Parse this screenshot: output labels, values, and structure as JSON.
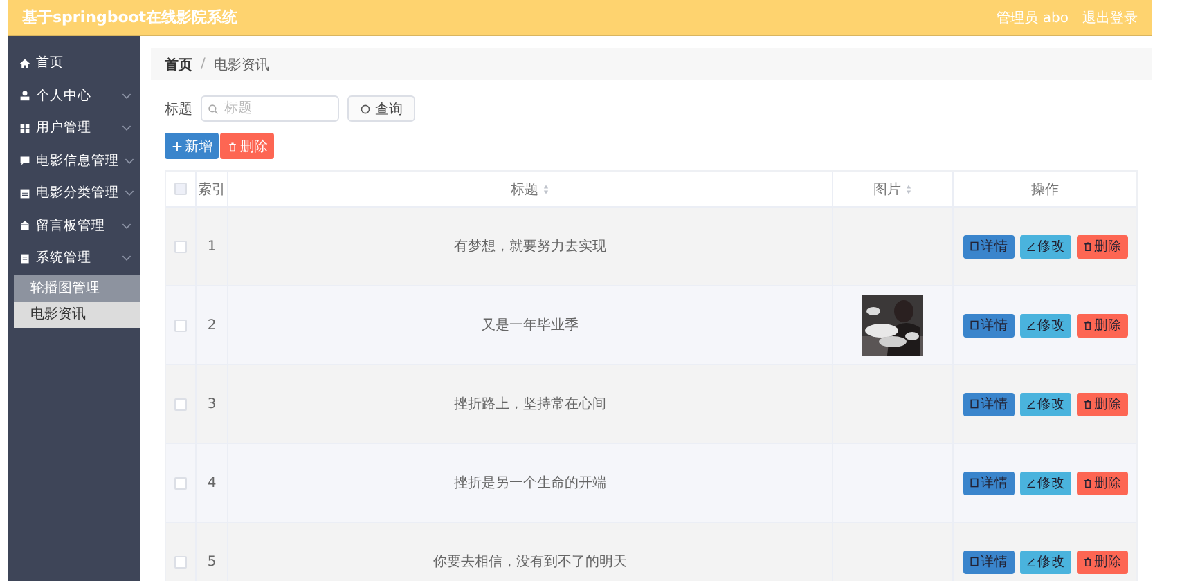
{
  "header": {
    "title": "基于springboot在线影院系统",
    "user": "管理员 abo",
    "logout": "退出登录"
  },
  "sidebar": {
    "items": [
      {
        "label": "首页",
        "kind": "home",
        "expandable": false
      },
      {
        "label": "个人中心",
        "kind": "user",
        "expandable": true
      },
      {
        "label": "用户管理",
        "kind": "grid",
        "expandable": true
      },
      {
        "label": "电影信息管理",
        "kind": "chat",
        "expandable": true
      },
      {
        "label": "电影分类管理",
        "kind": "list",
        "expandable": true
      },
      {
        "label": "留言板管理",
        "kind": "shop",
        "expandable": true
      },
      {
        "label": "系统管理",
        "kind": "doc",
        "expandable": true,
        "children": [
          {
            "label": "轮播图管理",
            "selected": false
          },
          {
            "label": "电影资讯",
            "selected": true
          }
        ]
      }
    ]
  },
  "breadcrumb": {
    "items": [
      "首页",
      "电影资讯"
    ],
    "separator": "/"
  },
  "search": {
    "label": "标题",
    "placeholder": "标题",
    "button": "查询"
  },
  "actions": [
    {
      "label": "新增",
      "kind": "add"
    },
    {
      "label": "删除",
      "kind": "delete"
    }
  ],
  "table": {
    "all_checked": false,
    "columns": [
      {
        "label": "索引",
        "sortable": false
      },
      {
        "label": "标题",
        "sortable": true
      },
      {
        "label": "图片",
        "sortable": true
      },
      {
        "label": "操作",
        "sortable": false
      }
    ],
    "rows": [
      {
        "checked": false,
        "index": "1",
        "title": "有梦想，就要努力去实现",
        "picture": false,
        "buttons": [
          "详情",
          "修改",
          "删除"
        ]
      },
      {
        "checked": false,
        "index": "2",
        "title": "又是一年毕业季",
        "picture": true,
        "buttons": [
          "详情",
          "修改",
          "删除"
        ]
      },
      {
        "checked": false,
        "index": "3",
        "title": "挫折路上，坚持常在心间",
        "picture": false,
        "buttons": [
          "详情",
          "修改",
          "删除"
        ]
      },
      {
        "checked": false,
        "index": "4",
        "title": "挫折是另一个生命的开端",
        "picture": false,
        "buttons": [
          "详情",
          "修改",
          "删除"
        ]
      },
      {
        "checked": false,
        "index": "5",
        "title": "你要去相信，没有到不了的明天",
        "picture": false,
        "buttons": [
          "详情",
          "修改",
          "删除"
        ]
      }
    ]
  }
}
